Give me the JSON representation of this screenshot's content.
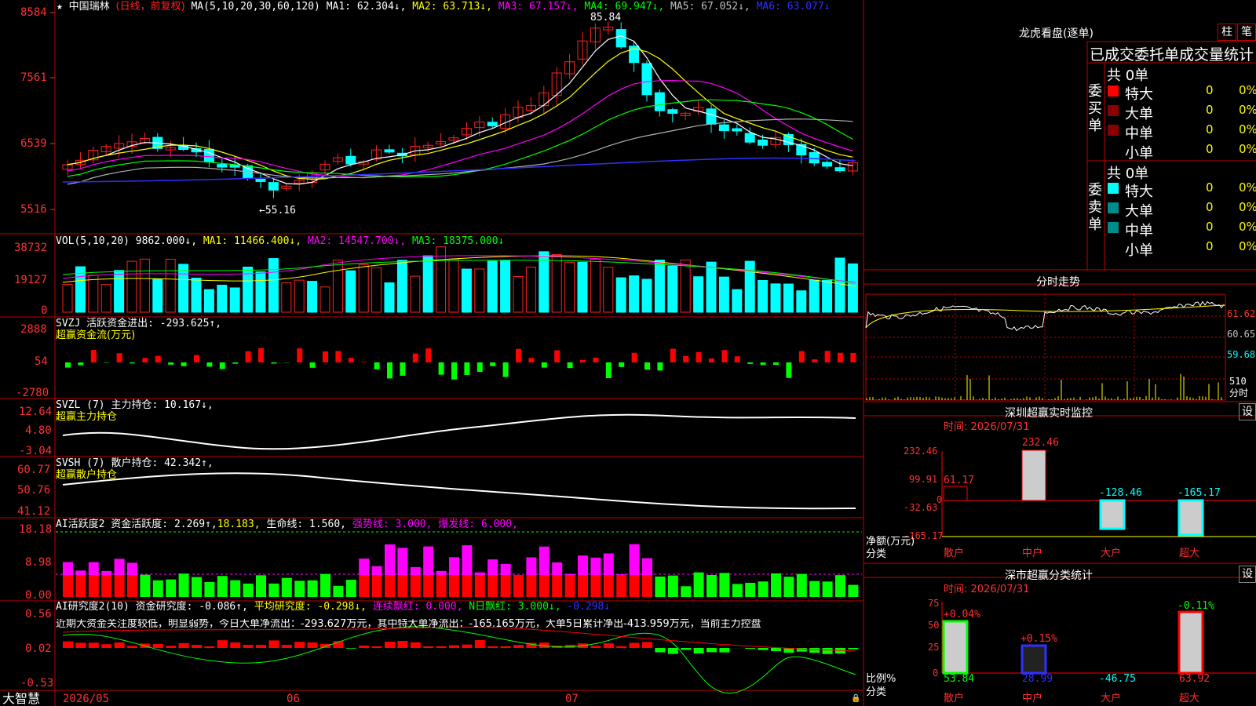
{
  "colors": {
    "up": "#ff2020",
    "down": "#00ffff",
    "red": "#ff0000",
    "yellow": "#ffff00",
    "magenta": "#ff00ff",
    "green": "#00ff00",
    "white": "#ffffff",
    "gray": "#a0a0a0",
    "blue": "#3030ff",
    "frame": "#c00000",
    "dim": "#8b0000"
  },
  "header": {
    "title_prefix": "★",
    "stock": "中国瑞林",
    "period": "(日线，前复权)",
    "ma_def": "MA(5,10,20,30,60,120)",
    "ma1": "MA1: 62.304↓,",
    "ma2": "MA2: 63.713↓,",
    "ma3": "MA3: 67.157↓,",
    "ma4": "MA4: 69.947↓,",
    "ma5": "MA5: 67.052↓,",
    "ma6": "MA6: 63.077↓"
  },
  "price_axis": [
    "8584",
    "7561",
    "6539",
    "5516"
  ],
  "price_high_label": "85.84",
  "price_low_label": "←55.16",
  "vol": {
    "def": "VOL(5,10,20)",
    "v": "9862.000↓,",
    "ma1": "MA1: 11466.400↓,",
    "ma2": "MA2: 14547.700↓,",
    "ma3": "MA3: 18375.000↓",
    "axis": [
      "38732",
      "19127",
      "0"
    ]
  },
  "svzj": {
    "l1": "SVZJ  活跃资金进出: -293.625↑,",
    "l2": "超赢资金流(万元)",
    "axis": [
      "2888",
      "54",
      "-2780"
    ]
  },
  "svzl": {
    "l1": "SVZL (7) 主力持仓: 10.167↓,",
    "l2": "超赢主力持仓",
    "axis": [
      "12.64",
      "4.80",
      "-3.04"
    ]
  },
  "svsh": {
    "l1": "SVSH (7) 散户持仓: 42.342↑,",
    "l2": "超赢散户持仓",
    "axis": [
      "60.77",
      "50.76",
      "41.12"
    ]
  },
  "ai1": {
    "a": "AI活跃度2 资金活跃度: 2.269↑,",
    "b": "18.183,",
    "c": "生命线: 1.560,",
    "d": "强势线: 3.000,",
    "e": "爆发线: 6.000,",
    "axis": [
      "18.18",
      "8.98",
      "0.00"
    ]
  },
  "ai2": {
    "a": "AI研究度2(10) 资金研究度: -0.086↑,",
    "b": "平均研究度: -0.298↓,",
    "c": "连续飘红: 0.000,",
    "d": "N日飘红: 3.000↓,",
    "e": "-0.298↓",
    "comment": "近期大资金关注度较低，明显弱势，今日大单净流出：-293.627万元，其中特大单净流出：-165.165万元，大单5日累计净出-413.959万元，当前主力控盘",
    "axis": [
      "0.56",
      "0.02",
      "-0.53"
    ]
  },
  "bottom": {
    "brand": "大智慧",
    "dates": [
      "2026/05",
      "06",
      "07"
    ]
  },
  "right": {
    "lhb_title": "龙虎看盘(逐单)",
    "btn_zhu": "柱",
    "btn_bi": "笔",
    "subtitle": "已成交委托单成交量统计",
    "buy_label": "委买单",
    "sell_label": "委卖单",
    "buy_total": "共 0单",
    "sell_total": "共 0单",
    "buy_rows": [
      {
        "name": "特大",
        "v": "0",
        "p": "0%",
        "c": "#ff0000"
      },
      {
        "name": "大单",
        "v": "0",
        "p": "0%",
        "c": "#8b0000"
      },
      {
        "name": "中单",
        "v": "0",
        "p": "0%",
        "c": "#8b0000"
      },
      {
        "name": "小单",
        "v": "0",
        "p": "0%",
        "c": ""
      }
    ],
    "sell_rows": [
      {
        "name": "特大",
        "v": "0",
        "p": "0%",
        "c": "#00ffff"
      },
      {
        "name": "大单",
        "v": "0",
        "p": "0%",
        "c": "#008b8b"
      },
      {
        "name": "中单",
        "v": "0",
        "p": "0%",
        "c": "#008b8b"
      },
      {
        "name": "小单",
        "v": "0",
        "p": "0%",
        "c": ""
      }
    ],
    "intraday_title": "分时走势",
    "intraday_axis": [
      "61.62",
      "60.65",
      "59.68"
    ],
    "intraday_vol": "510",
    "intraday_vol_unit": "分时",
    "sz_title": "深圳超赢实时监控",
    "sz_btn": "设",
    "sz_time": "时间: 2026/07/31",
    "sz_axis": [
      "232.46",
      "99.91",
      "0",
      "-32.63",
      "-165.17"
    ],
    "sz_unit1": "净额(万元)",
    "sz_unit2": "分类",
    "sz_cats": [
      "散户",
      "中户",
      "大户",
      "超大"
    ],
    "sz_values": [
      "61.17",
      "232.46",
      "-128.46",
      "-165.17"
    ],
    "sm_title": "深市超赢分类统计",
    "sm_btn": "设",
    "sm_time": "时间: 2026/07/31",
    "sm_axis": [
      "75",
      "50",
      "25",
      "0"
    ],
    "sm_unit1": "比例%",
    "sm_unit2": "分类",
    "sm_cats": [
      "散户",
      "中户",
      "大户",
      "超大"
    ],
    "sm_pct": [
      "+0.04%",
      "+0.15%",
      "",
      "-0.11%"
    ],
    "sm_values": [
      "53.84",
      "28.99",
      "-46.75",
      "63.92"
    ]
  }
}
